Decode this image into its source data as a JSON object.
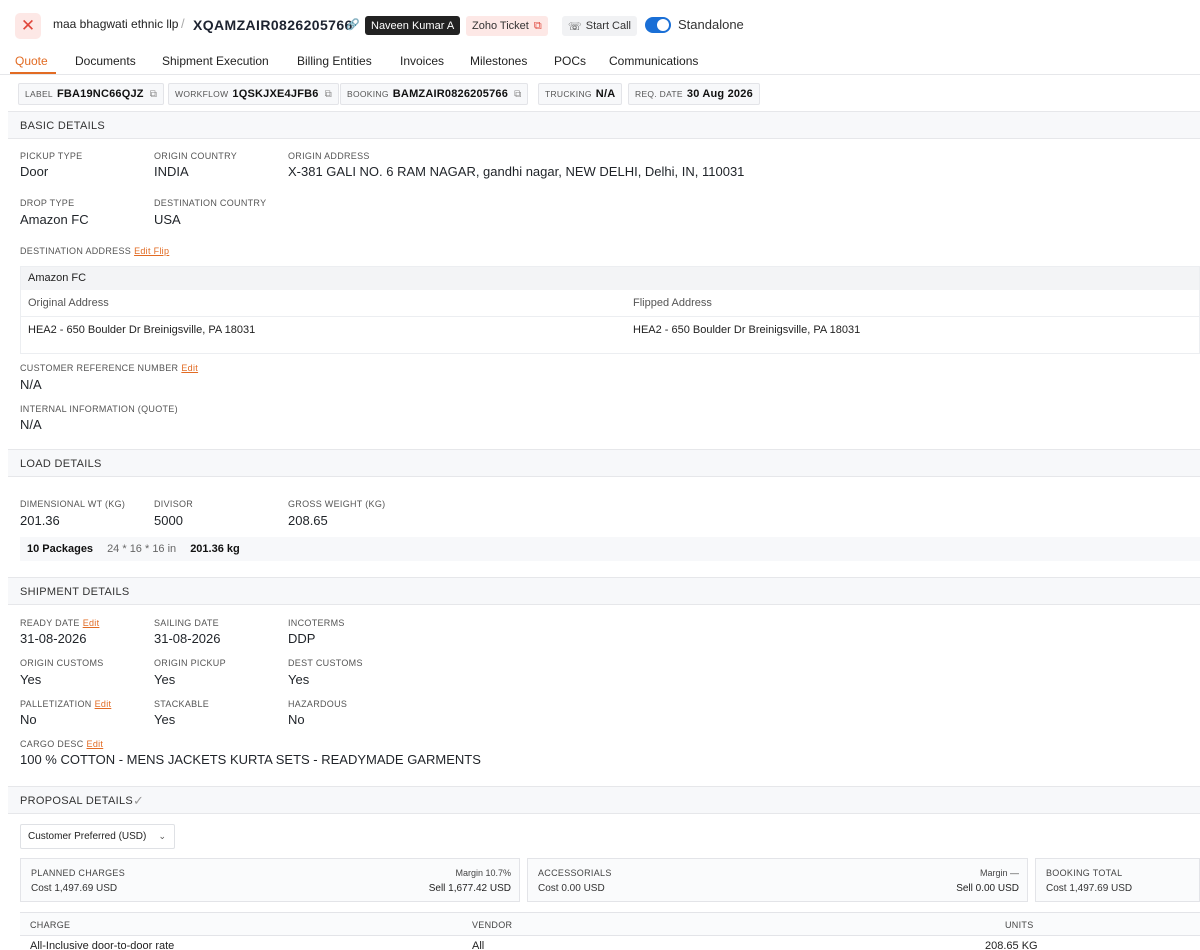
{
  "header": {
    "close_icon": "close-icon",
    "company": "maa bhagwati ethnic llp",
    "separator": "/",
    "shipment_id": "XQAMZAIR0826205766",
    "link_icon": "link-icon",
    "assignee": "Naveen Kumar A",
    "zoho_ticket": "Zoho Ticket",
    "start_call": "Start Call",
    "standalone_label": "Standalone",
    "standalone_on": true
  },
  "tabs": [
    "Quote",
    "Documents",
    "Shipment Execution",
    "Billing Entities",
    "Invoices",
    "Milestones",
    "POCs",
    "Communications"
  ],
  "chips": {
    "label_k": "LABEL",
    "label_v": "FBA19NC66QJZ",
    "workflow_k": "WORKFLOW",
    "workflow_v": "1QSKJXE4JFB6",
    "booking_k": "BOOKING",
    "booking_v": "BAMZAIR0826205766",
    "trucking_k": "TRUCKING",
    "trucking_v": "N/A",
    "reqdate_k": "REQ. DATE",
    "reqdate_v": "30 Aug 2026"
  },
  "basic": {
    "title": "BASIC DETAILS",
    "pickup_type_l": "PICKUP TYPE",
    "pickup_type_v": "Door",
    "origin_country_l": "ORIGIN COUNTRY",
    "origin_country_v": "INDIA",
    "origin_address_l": "ORIGIN ADDRESS",
    "origin_address_v": "X-381 GALI NO. 6 RAM NAGAR, gandhi nagar, NEW DELHI, Delhi, IN, 110031",
    "drop_type_l": "DROP TYPE",
    "drop_type_v": "Amazon FC",
    "dest_country_l": "DESTINATION COUNTRY",
    "dest_country_v": "USA",
    "dest_address_l": "DESTINATION ADDRESS",
    "dest_address_edit": "Edit Flip",
    "dest_name": "Amazon FC",
    "orig_addr_h": "Original Address",
    "flip_addr_h": "Flipped Address",
    "orig_addr_v": "HEA2 - 650 Boulder Dr Breinigsville, PA 18031",
    "flip_addr_v": "HEA2 - 650 Boulder Dr Breinigsville, PA 18031",
    "crn_l": "CUSTOMER REFERENCE NUMBER",
    "crn_edit": "Edit",
    "crn_v": "N/A",
    "internal_l": "INTERNAL INFORMATION (QUOTE)",
    "internal_v": "N/A"
  },
  "load": {
    "title": "LOAD DETAILS",
    "dim_l": "DIMENSIONAL WT (KG)",
    "dim_v": "201.36",
    "divisor_l": "DIVISOR",
    "divisor_v": "5000",
    "gross_l": "GROSS WEIGHT (KG)",
    "gross_v": "208.65",
    "pkg_count": "10 Packages",
    "pkg_dims": "24 * 16 * 16 in",
    "pkg_wt": "201.36 kg"
  },
  "shipment": {
    "title": "SHIPMENT DETAILS",
    "ready_l": "READY DATE",
    "ready_edit": "Edit",
    "ready_v": "31-08-2026",
    "sailing_l": "SAILING DATE",
    "sailing_v": "31-08-2026",
    "inco_l": "INCOTERMS",
    "inco_v": "DDP",
    "ocust_l": "ORIGIN CUSTOMS",
    "ocust_v": "Yes",
    "opick_l": "ORIGIN PICKUP",
    "opick_v": "Yes",
    "dcust_l": "DEST CUSTOMS",
    "dcust_v": "Yes",
    "pallet_l": "PALLETIZATION",
    "pallet_edit": "Edit",
    "pallet_v": "No",
    "stack_l": "STACKABLE",
    "stack_v": "Yes",
    "haz_l": "HAZARDOUS",
    "haz_v": "No",
    "cargo_l": "CARGO DESC",
    "cargo_edit": "Edit",
    "cargo_v": "100 % COTTON - MENS JACKETS KURTA SETS - READYMADE GARMENTS"
  },
  "proposal": {
    "title": "PROPOSAL DETAILS",
    "selected_option": "Customer Preferred (USD)",
    "planned_t": "PLANNED CHARGES",
    "planned_cost": "Cost 1,497.69 USD",
    "planned_margin": "Margin 10.7%",
    "planned_sell": "Sell 1,677.42 USD",
    "acc_t": "ACCESSORIALS",
    "acc_cost": "Cost 0.00 USD",
    "acc_margin": "Margin —",
    "acc_sell": "Sell 0.00 USD",
    "total_t": "BOOKING TOTAL",
    "total_cost": "Cost 1,497.69 USD",
    "col_charge": "CHARGE",
    "col_vendor": "VENDOR",
    "col_units": "UNITS",
    "row1_charge": "All-Inclusive door-to-door rate",
    "row1_vendor": "All",
    "row1_units": "208.65 KG"
  }
}
